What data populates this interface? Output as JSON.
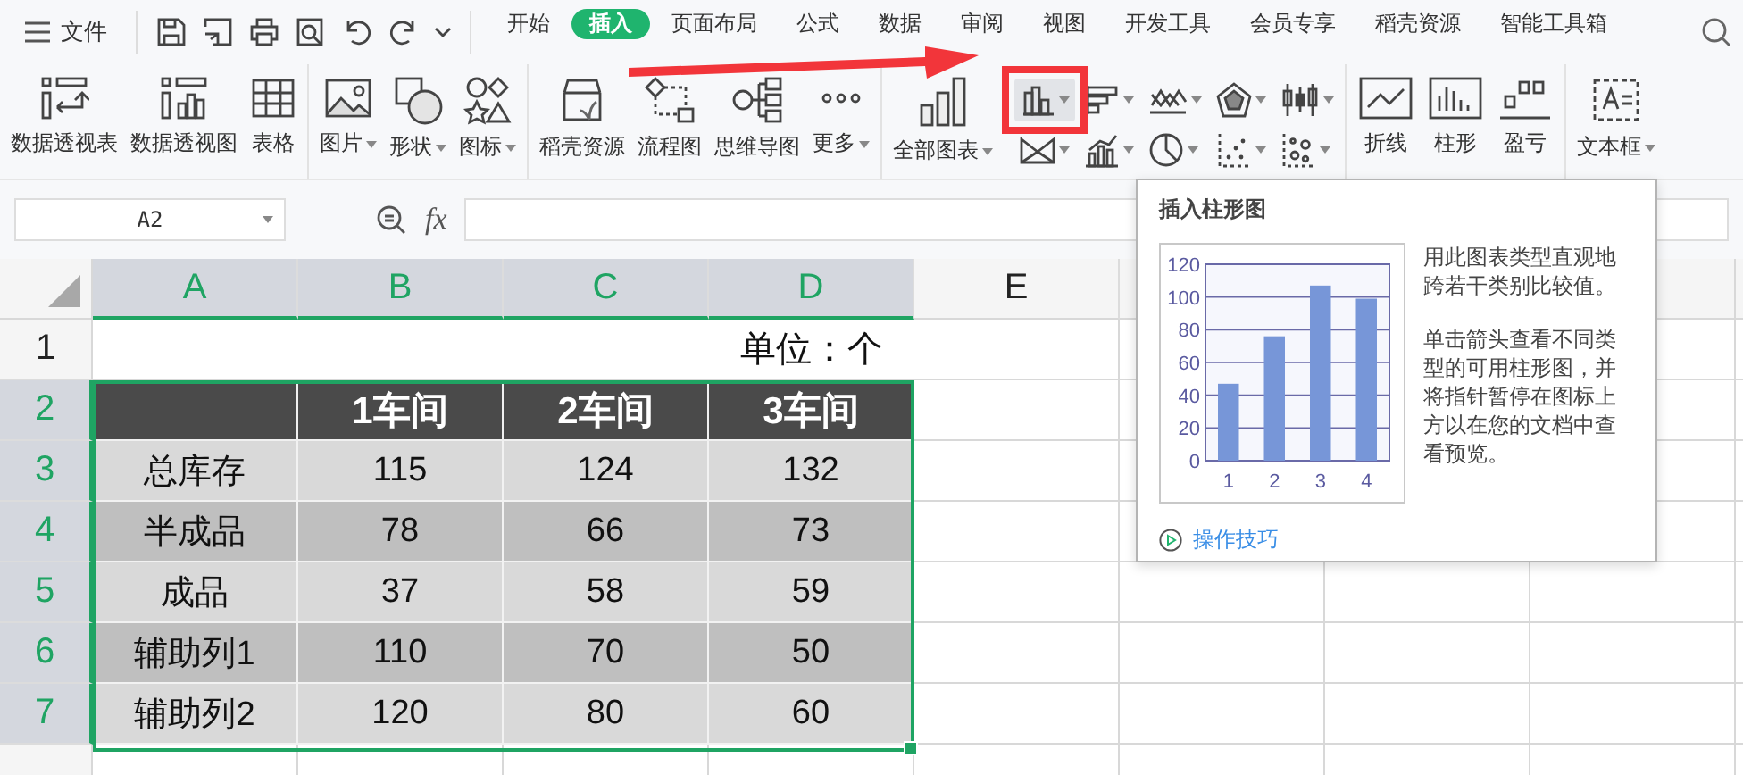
{
  "menu": {
    "label": "文件"
  },
  "tabs": [
    {
      "label": "开始",
      "selected": false
    },
    {
      "label": "插入",
      "selected": true
    },
    {
      "label": "页面布局",
      "selected": false
    },
    {
      "label": "公式",
      "selected": false
    },
    {
      "label": "数据",
      "selected": false
    },
    {
      "label": "审阅",
      "selected": false
    },
    {
      "label": "视图",
      "selected": false
    },
    {
      "label": "开发工具",
      "selected": false
    },
    {
      "label": "会员专享",
      "selected": false
    },
    {
      "label": "稻壳资源",
      "selected": false
    },
    {
      "label": "智能工具箱",
      "selected": false
    }
  ],
  "ribbon": {
    "groups": [
      [
        {
          "kind": "pivot-table",
          "label": "数据透视表",
          "dropdown": false
        },
        {
          "kind": "pivot-chart",
          "label": "数据透视图",
          "dropdown": false
        },
        {
          "kind": "table",
          "label": "表格",
          "dropdown": false
        }
      ],
      [
        {
          "kind": "picture",
          "label": "图片",
          "dropdown": true
        },
        {
          "kind": "shape",
          "label": "形状",
          "dropdown": true
        },
        {
          "kind": "icons",
          "label": "图标",
          "dropdown": true
        }
      ],
      [
        {
          "kind": "store",
          "label": "稻壳资源",
          "dropdown": false
        },
        {
          "kind": "flow",
          "label": "流程图",
          "dropdown": false
        },
        {
          "kind": "mind",
          "label": "思维导图",
          "dropdown": false
        },
        {
          "kind": "more",
          "label": "更多",
          "dropdown": true
        }
      ],
      [
        {
          "kind": "all-charts",
          "label": "全部图表",
          "dropdown": true
        }
      ],
      [
        {
          "kind": "spark-line",
          "label": "折线",
          "dropdown": false
        },
        {
          "kind": "spark-column",
          "label": "柱形",
          "dropdown": false
        },
        {
          "kind": "spark-winloss",
          "label": "盈亏",
          "dropdown": false
        }
      ],
      [
        {
          "kind": "textbox",
          "label": "文本框",
          "dropdown": true
        }
      ]
    ],
    "chart_buttons": [
      {
        "kind": "column",
        "hovered": true
      },
      {
        "kind": "bar",
        "hovered": false
      },
      {
        "kind": "line",
        "hovered": false
      },
      {
        "kind": "radar",
        "hovered": false
      },
      {
        "kind": "stock",
        "hovered": false
      },
      {
        "kind": "area",
        "hovered": false
      },
      {
        "kind": "combo",
        "hovered": false
      },
      {
        "kind": "pie",
        "hovered": false
      },
      {
        "kind": "scatter",
        "hovered": false
      },
      {
        "kind": "bubble",
        "hovered": false
      }
    ]
  },
  "name_box": {
    "value": "A2"
  },
  "formula_bar": {
    "fx": "fx"
  },
  "sheet": {
    "columns": [
      {
        "label": "A",
        "selected": true
      },
      {
        "label": "B",
        "selected": true
      },
      {
        "label": "C",
        "selected": true
      },
      {
        "label": "D",
        "selected": true
      },
      {
        "label": "E",
        "selected": false
      }
    ],
    "rows": [
      {
        "number": "1",
        "selected": false,
        "kind": "title",
        "cells": [
          "",
          "",
          "",
          "单位：个"
        ]
      },
      {
        "number": "2",
        "selected": true,
        "kind": "header",
        "cells": [
          "",
          "1车间",
          "2车间",
          "3车间"
        ]
      },
      {
        "number": "3",
        "selected": true,
        "kind": "light",
        "cells": [
          "总库存",
          "115",
          "124",
          "132"
        ]
      },
      {
        "number": "4",
        "selected": true,
        "kind": "dark",
        "cells": [
          "半成品",
          "78",
          "66",
          "73"
        ]
      },
      {
        "number": "5",
        "selected": true,
        "kind": "light",
        "cells": [
          "成品",
          "37",
          "58",
          "59"
        ]
      },
      {
        "number": "6",
        "selected": true,
        "kind": "dark",
        "cells": [
          "辅助列1",
          "110",
          "70",
          "50"
        ]
      },
      {
        "number": "7",
        "selected": true,
        "kind": "light",
        "cells": [
          "辅助列2",
          "120",
          "80",
          "60"
        ]
      }
    ]
  },
  "tooltip": {
    "title": "插入柱形图",
    "chart_data": {
      "type": "bar",
      "grid": true,
      "categories": [
        "1",
        "2",
        "3",
        "4"
      ],
      "values": [
        47,
        76,
        107,
        99
      ],
      "ylim": [
        0,
        120
      ],
      "yticks": [
        0,
        20,
        40,
        60,
        80,
        100,
        120
      ]
    },
    "paragraphs": [
      "用此图表类型直观地跨若干类别比较值。",
      "单击箭头查看不同类型的可用柱形图，并将指针暂停在图标上方以在您的文档中查看预览。"
    ],
    "link": "操作技巧"
  }
}
